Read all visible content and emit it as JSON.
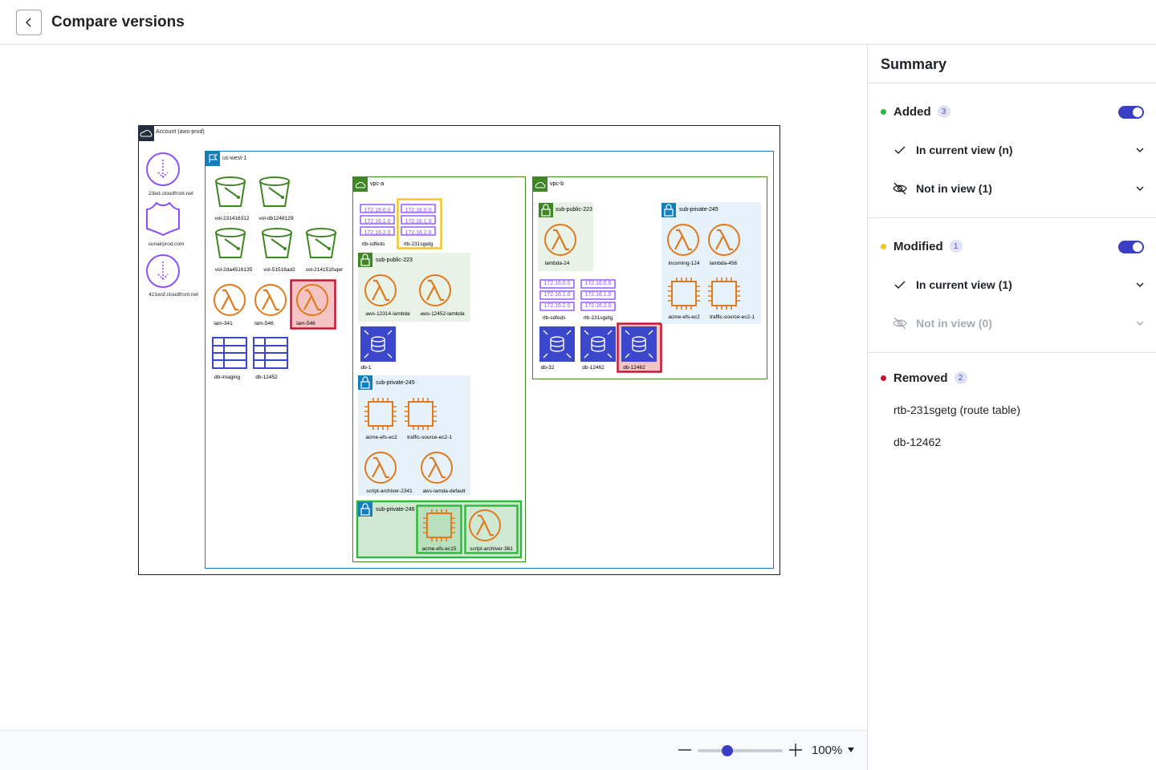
{
  "header": {
    "title": "Compare versions"
  },
  "zoom": {
    "value": "100%",
    "level": 0.35
  },
  "diagram": {
    "account": "Account (aws-prod)",
    "region": "us-west-1",
    "vpc_a": "vpc-a",
    "vpc_b": "vpc-b",
    "edge": [
      {
        "label": "23ed.cloudfront.net",
        "icon": "cloudfront-icon"
      },
      {
        "label": "sunairprod.com",
        "icon": "route53-shield-icon"
      },
      {
        "label": "421wsf.cloudfront.net",
        "icon": "cloudfront-icon"
      }
    ],
    "buckets": [
      "vol-231416312",
      "vol-db1248129",
      "vol-2da4516135",
      "vol-51516ad2",
      "vol-214151fsqer"
    ],
    "region_lambdas": [
      "lam-341",
      "lam-546",
      "lam-546"
    ],
    "tables": [
      "db-imaging",
      "db-12452"
    ],
    "cidrs": [
      "172.16.0.0",
      "172.16.1.0",
      "172.16.2.0"
    ],
    "vpc_a_rtbs": [
      "rtb-sdfeds",
      "rtb-231sgetg"
    ],
    "sub_public_a": {
      "name": "sub-public-223",
      "items": [
        "aws-12314-lambda",
        "aws-12452-lambda"
      ]
    },
    "vpc_a_db": "db-1",
    "sub_private_a": {
      "name": "sub-private-245",
      "items": [
        "acme-efs-ec2",
        "traffic-source-ec2-1",
        "script-archiver-2341",
        "aws-lamda-default"
      ]
    },
    "sub_private_new": {
      "name": "sub-private-246",
      "items": [
        "acme-efs-ec15",
        "script-archiver-361"
      ]
    },
    "sub_public_b": {
      "name": "sub-public-223",
      "items": [
        "lambda-24"
      ]
    },
    "vpc_b_rtbs": [
      "rtb-sdfeds",
      "rtb-231sgetg"
    ],
    "vpc_b_dbs": [
      "db-32",
      "db-12462",
      "db-12462"
    ],
    "sub_private_b": {
      "name": "sub-private-245",
      "items": [
        "incoming-124",
        "lambda-456",
        "acme-efs-ec2",
        "traffic-source-ec2-1"
      ]
    }
  },
  "summary": {
    "title": "Summary",
    "added": {
      "label": "Added",
      "count": "3",
      "color": "#2eb83a",
      "rows": [
        {
          "label": "In current view (n)",
          "icon": "check-icon"
        },
        {
          "label": "Not in view (1)",
          "icon": "eye-off-icon"
        }
      ]
    },
    "modified": {
      "label": "Modified",
      "count": "1",
      "color": "#f5c31c",
      "rows": [
        {
          "label": "In current view (1)",
          "icon": "check-icon"
        },
        {
          "label": "Not in view (0)",
          "icon": "eye-off-icon"
        }
      ]
    },
    "removed": {
      "label": "Removed",
      "count": "2",
      "color": "#c8102e",
      "items": [
        "rtb-231sgetg (route table)",
        "db-12462"
      ]
    }
  },
  "colors": {
    "accent": "#3b3fc4",
    "s3": "#3f8624",
    "lambda": "#e07a1f",
    "network": "#8c4fff",
    "db": "#3b48cc",
    "region": "#147eba",
    "vpc": "#3f8624",
    "added": "#2eb83a",
    "removed": "#c8102e",
    "modified": "#f5c31c"
  }
}
